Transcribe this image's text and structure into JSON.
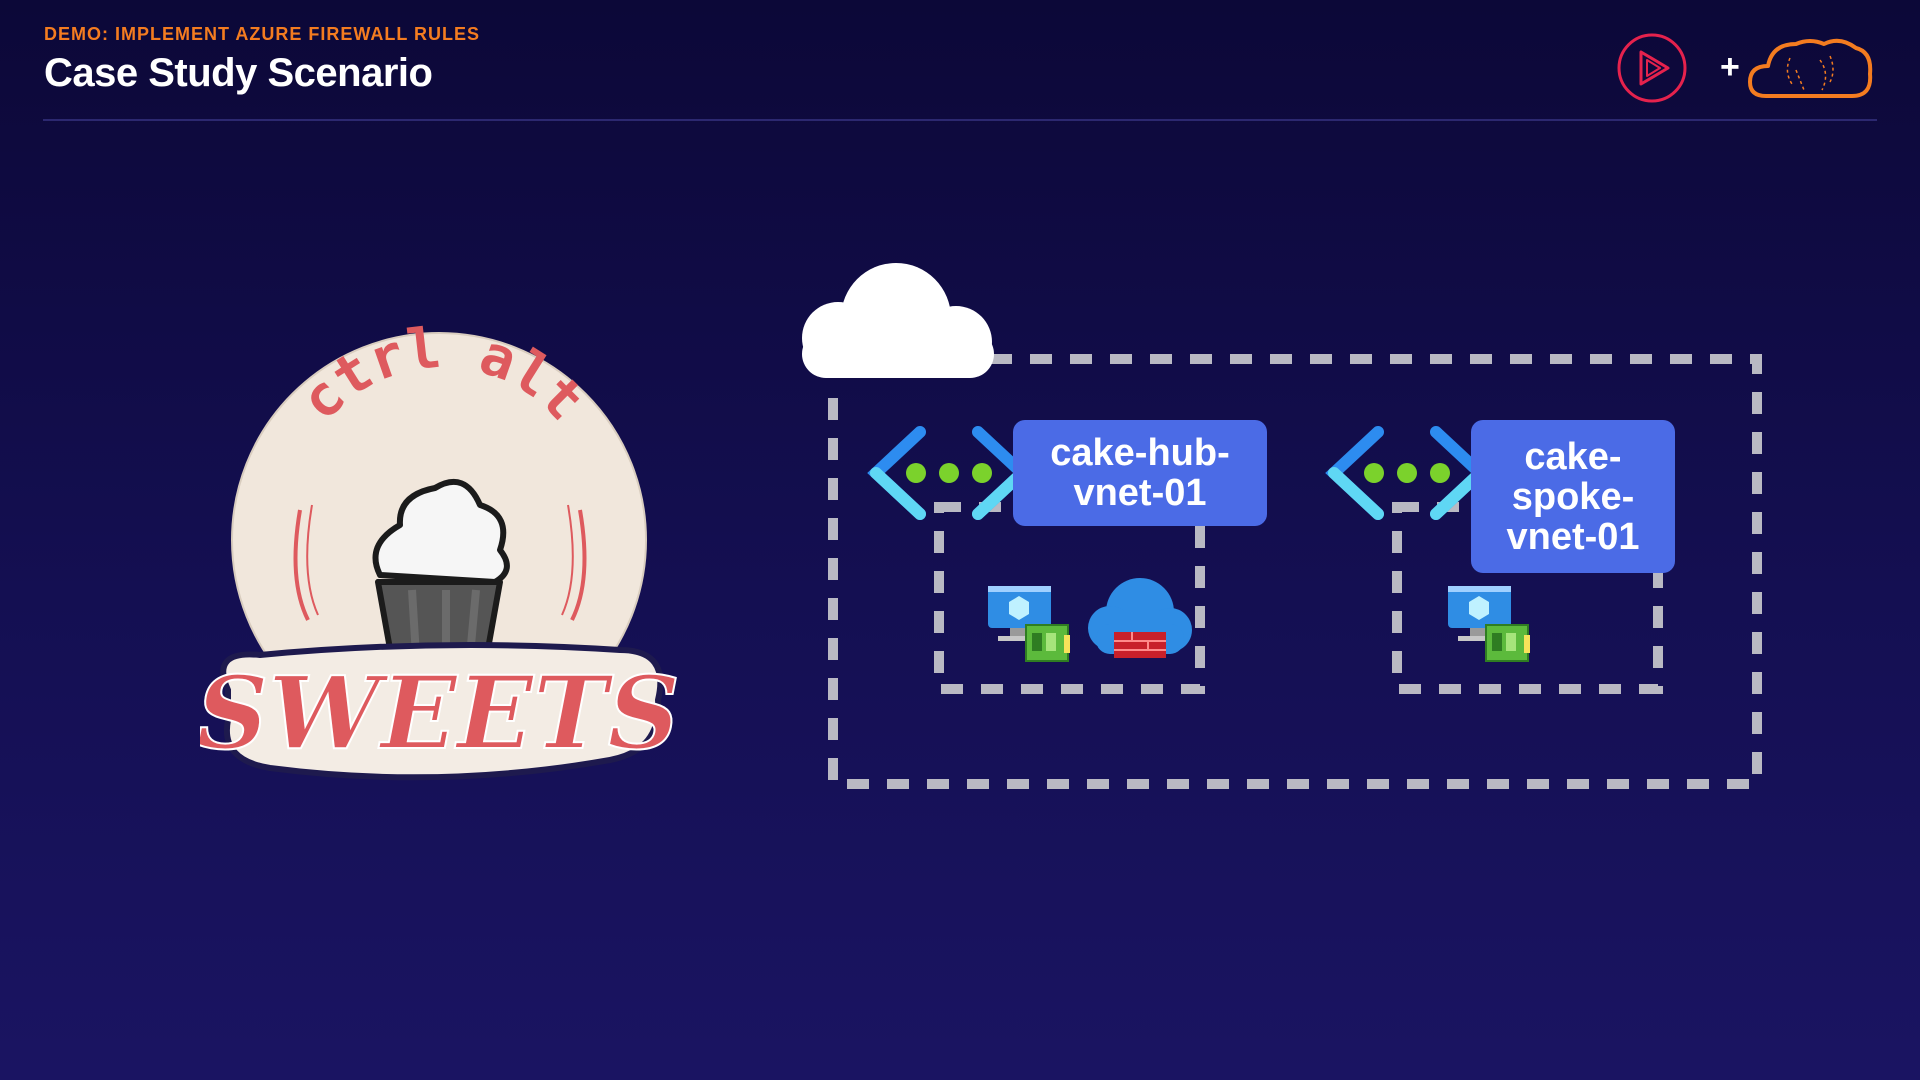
{
  "header": {
    "kicker": "DEMO: IMPLEMENT AZURE FIREWALL RULES",
    "title": "Case Study Scenario"
  },
  "brand": {
    "plus": "+",
    "colors": {
      "play": "#e5224d",
      "cloud": "#f47c20"
    }
  },
  "logo": {
    "top_text": "ctrl alt",
    "bottom_text": "SWEETS",
    "colors": {
      "text": "#de5a5e",
      "badge": "#f1e7dc",
      "frosting": "#f6f6f6",
      "cup": "#555555"
    }
  },
  "diagram": {
    "hub_vnet_label": "cake-hub-\nvnet-01",
    "spoke_vnet_label": "cake-\nspoke-\nvnet-01",
    "icons": [
      "cloud-icon",
      "vnet-icon",
      "virtual-machine-icon",
      "firewall-icon"
    ],
    "colors": {
      "label_bg": "#4b6be6",
      "dash": "#b9b9c3",
      "vnet_bracket": "#2d8cf0",
      "vnet_dots": "#7bd22c"
    }
  }
}
